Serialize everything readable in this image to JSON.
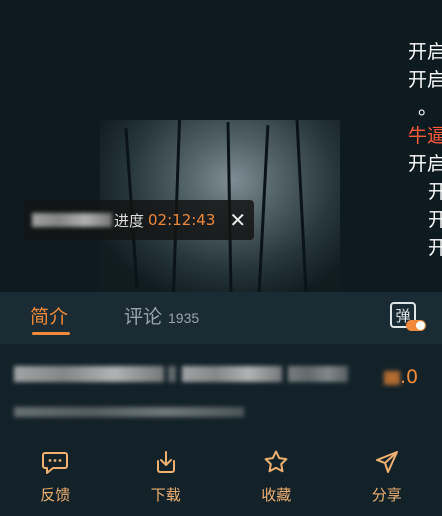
{
  "video": {
    "side_text_lines": [
      "开启",
      "开启",
      "。",
      "牛逼",
      "开启",
      "开",
      "开",
      "开"
    ],
    "resume_bar": {
      "label_tail": "进度",
      "time": "02:12:43",
      "close_symbol": "✕"
    }
  },
  "tabs": {
    "intro": "简介",
    "comments": "评论",
    "comments_count": "1935",
    "danmaku_label": "弹"
  },
  "content": {
    "rating_tail": ".0"
  },
  "bottom_nav": [
    {
      "label": "反馈",
      "icon": "chat-bubble-icon"
    },
    {
      "label": "下载",
      "icon": "download-icon"
    },
    {
      "label": "收藏",
      "icon": "star-icon"
    },
    {
      "label": "分享",
      "icon": "send-icon"
    }
  ],
  "colors": {
    "accent": "#f08a3a",
    "background": "#132229",
    "tab_bar": "#1a2b33",
    "side_text_accent": "#ff5a3a"
  }
}
